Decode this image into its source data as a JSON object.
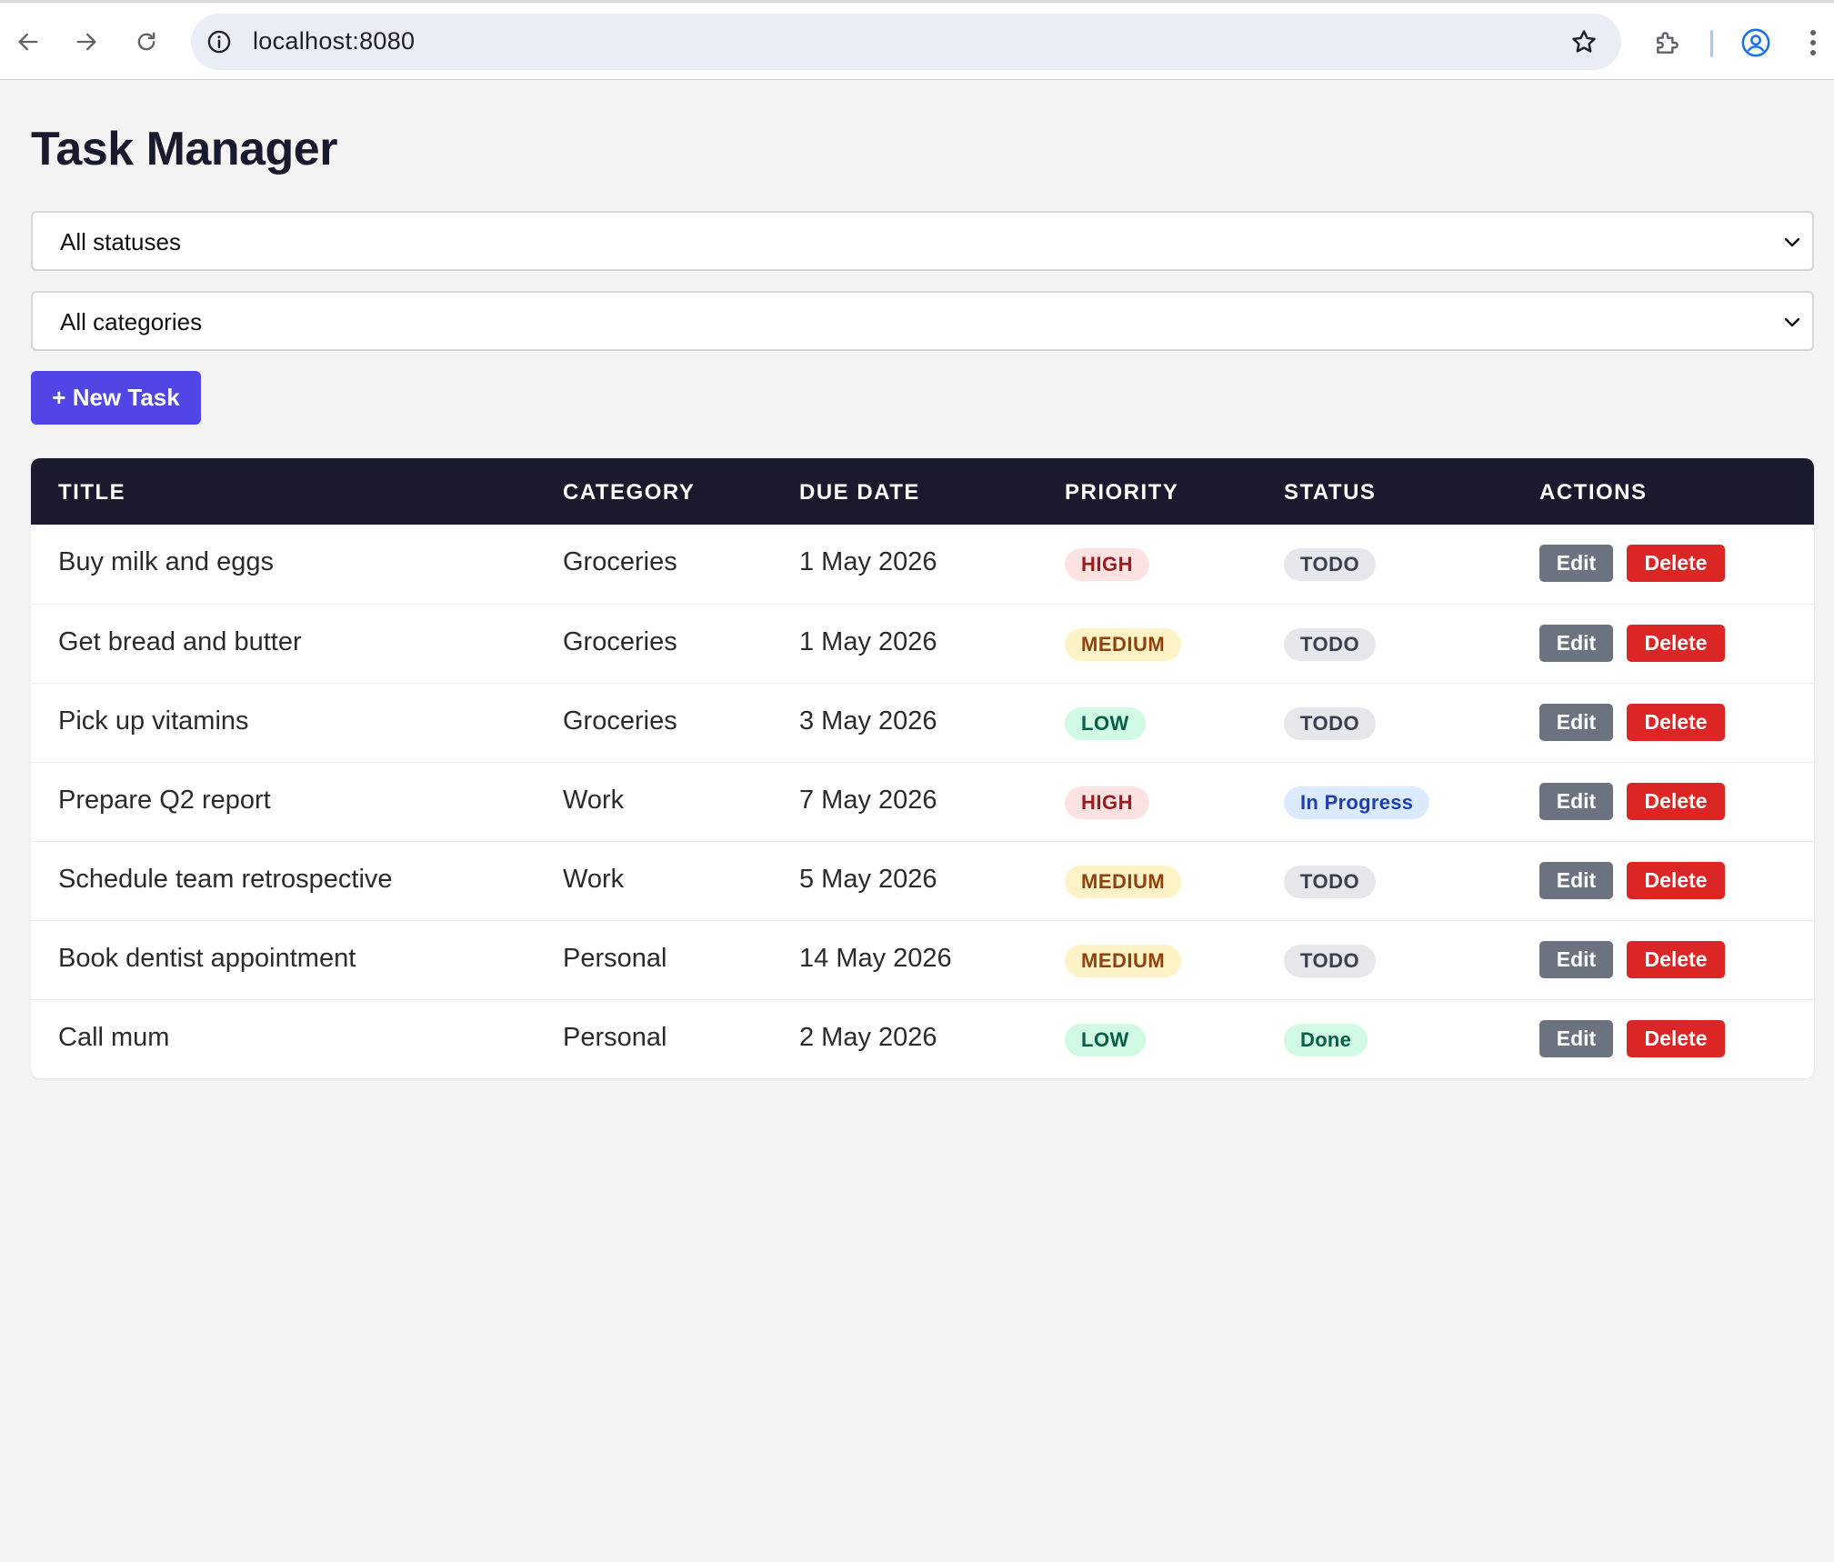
{
  "browser": {
    "url": "localhost:8080"
  },
  "page": {
    "title": "Task Manager"
  },
  "filters": {
    "status": {
      "selected": "All statuses"
    },
    "category": {
      "selected": "All categories"
    }
  },
  "toolbar": {
    "new_task_label": "+ New Task"
  },
  "table": {
    "headers": {
      "title": "TITLE",
      "category": "CATEGORY",
      "due_date": "DUE DATE",
      "priority": "PRIORITY",
      "status": "STATUS",
      "actions": "ACTIONS"
    },
    "edit_label": "Edit",
    "delete_label": "Delete",
    "rows": [
      {
        "title": "Buy milk and eggs",
        "category": "Groceries",
        "due_date": "1 May 2026",
        "priority": "HIGH",
        "status": "TODO"
      },
      {
        "title": "Get bread and butter",
        "category": "Groceries",
        "due_date": "1 May 2026",
        "priority": "MEDIUM",
        "status": "TODO"
      },
      {
        "title": "Pick up vitamins",
        "category": "Groceries",
        "due_date": "3 May 2026",
        "priority": "LOW",
        "status": "TODO"
      },
      {
        "title": "Prepare Q2 report",
        "category": "Work",
        "due_date": "7 May 2026",
        "priority": "HIGH",
        "status": "In Progress"
      },
      {
        "title": "Schedule team retrospective",
        "category": "Work",
        "due_date": "5 May 2026",
        "priority": "MEDIUM",
        "status": "TODO"
      },
      {
        "title": "Book dentist appointment",
        "category": "Personal",
        "due_date": "14 May 2026",
        "priority": "MEDIUM",
        "status": "TODO"
      },
      {
        "title": "Call mum",
        "category": "Personal",
        "due_date": "2 May 2026",
        "priority": "LOW",
        "status": "Done"
      }
    ]
  },
  "colors": {
    "accent": "#4f46e5",
    "header_bg": "#1a1a2e",
    "delete": "#dc2626",
    "edit": "#6b7280"
  },
  "icons": {
    "back": "arrow-left-icon",
    "forward": "arrow-right-icon",
    "reload": "reload-icon",
    "site_info": "info-icon",
    "bookmark": "star-icon",
    "extensions": "puzzle-icon",
    "profile": "profile-icon",
    "menu": "kebab-menu-icon",
    "dropdown": "chevron-down-icon"
  }
}
